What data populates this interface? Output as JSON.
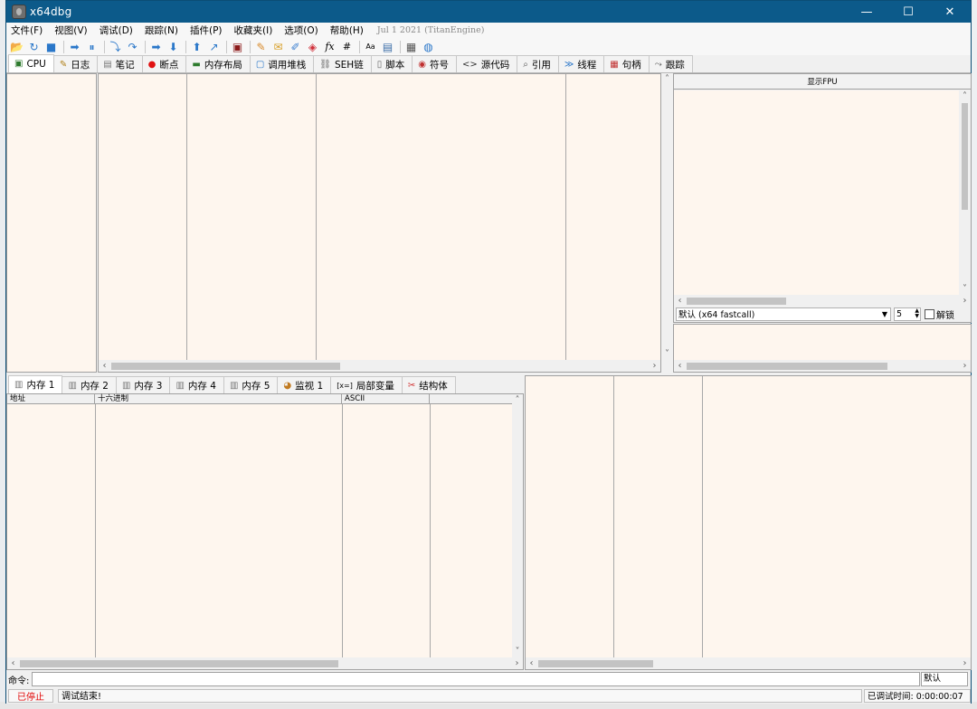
{
  "window": {
    "title": "x64dbg",
    "minimize": "—",
    "maximize": "☐",
    "close": "✕"
  },
  "menu": {
    "items": [
      "文件(F)",
      "视图(V)",
      "调试(D)",
      "跟踪(N)",
      "插件(P)",
      "收藏夹(I)",
      "选项(O)",
      "帮助(H)"
    ],
    "version": "Jul 1 2021 (TitanEngine)"
  },
  "toolbar": {
    "icons": [
      "open-icon",
      "restart-icon",
      "stop-icon",
      "run-icon",
      "pause-icon",
      "step-into-icon",
      "step-over-icon",
      "trace-into-icon",
      "trace-over-icon",
      "execute-till-return-icon",
      "run-to-user-code-icon",
      "scylla-icon",
      "patch-icon",
      "comment-icon",
      "label-icon",
      "bookmark-icon",
      "function-icon",
      "hash-icon",
      "strings-icon",
      "calculator-icon",
      "memory-icon",
      "globe-icon"
    ],
    "glyphs": [
      "📂",
      "↻",
      "■",
      "➡",
      "⏸",
      "⤵",
      "↷",
      "➡",
      "⬇",
      "⬆",
      "↗",
      "▣",
      "✎",
      "✉",
      "✐",
      "◈",
      "fx",
      "#",
      "Aa",
      "▤",
      "▦",
      "◍"
    ]
  },
  "tabs_top": [
    {
      "label": "CPU",
      "icon": "cpu-icon",
      "glyph": "▣"
    },
    {
      "label": "日志",
      "icon": "log-icon",
      "glyph": "✎"
    },
    {
      "label": "笔记",
      "icon": "notes-icon",
      "glyph": "▤"
    },
    {
      "label": "断点",
      "icon": "breakpoint-icon",
      "glyph": "●"
    },
    {
      "label": "内存布局",
      "icon": "memory-map-icon",
      "glyph": "▬"
    },
    {
      "label": "调用堆栈",
      "icon": "call-stack-icon",
      "glyph": "▢"
    },
    {
      "label": "SEH链",
      "icon": "seh-icon",
      "glyph": "⛓"
    },
    {
      "label": "脚本",
      "icon": "script-icon",
      "glyph": "▯"
    },
    {
      "label": "符号",
      "icon": "symbol-icon",
      "glyph": "◉"
    },
    {
      "label": "源代码",
      "icon": "source-icon",
      "glyph": "<>"
    },
    {
      "label": "引用",
      "icon": "reference-icon",
      "glyph": "⌕"
    },
    {
      "label": "线程",
      "icon": "thread-icon",
      "glyph": "≫"
    },
    {
      "label": "句柄",
      "icon": "handle-icon",
      "glyph": "▦"
    },
    {
      "label": "跟踪",
      "icon": "trace-icon",
      "glyph": "⤳"
    }
  ],
  "fpu": {
    "toggle_label": "显示FPU"
  },
  "calling_convention": {
    "selected": "默认 (x64 fastcall)",
    "arg_count": "5",
    "unlock_label": "解锁"
  },
  "tabs_mem": [
    {
      "label": "内存 1",
      "icon": "dump-icon",
      "glyph": "▥"
    },
    {
      "label": "内存 2",
      "icon": "dump-icon",
      "glyph": "▥"
    },
    {
      "label": "内存 3",
      "icon": "dump-icon",
      "glyph": "▥"
    },
    {
      "label": "内存 4",
      "icon": "dump-icon",
      "glyph": "▥"
    },
    {
      "label": "内存 5",
      "icon": "dump-icon",
      "glyph": "▥"
    },
    {
      "label": "监视 1",
      "icon": "watch-icon",
      "glyph": "◕"
    },
    {
      "label": "局部变量",
      "icon": "locals-icon",
      "glyph": "[x=]"
    },
    {
      "label": "结构体",
      "icon": "struct-icon",
      "glyph": "✂"
    }
  ],
  "dump_columns": [
    "地址",
    "十六进制",
    "ASCII",
    ""
  ],
  "command": {
    "label": "命令:",
    "default_label": "默认"
  },
  "status": {
    "state": "已停止",
    "message": "调试结束!",
    "time": "已调试时间: 0:00:00:07"
  },
  "colors": {
    "title_bar": "#0c5a8a",
    "pane_background": "#fef6ee",
    "stopped_text": "#e00000"
  }
}
